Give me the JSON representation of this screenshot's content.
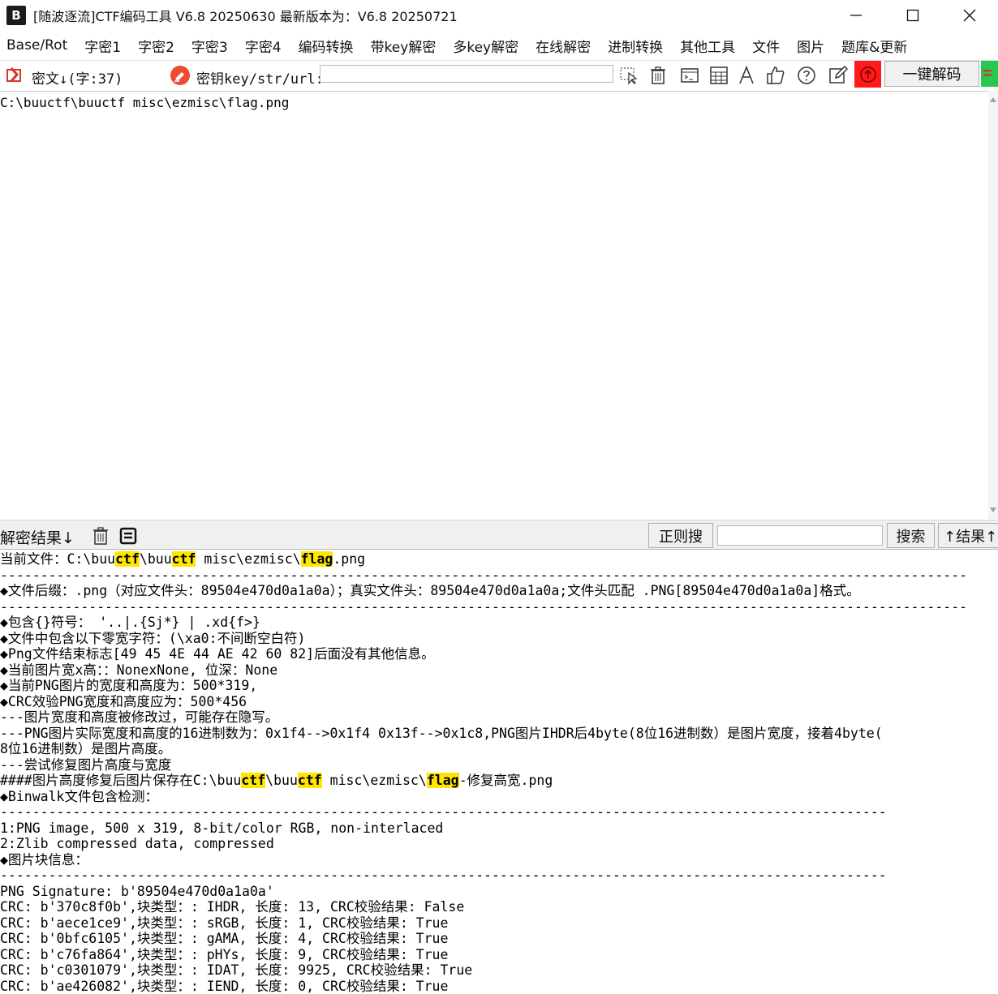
{
  "window": {
    "logo": "B",
    "title": "[随波逐流]CTF编码工具 V6.8 20250630    最新版本为：V6.8 20250721"
  },
  "menu": [
    "Base/Rot",
    "字密1",
    "字密2",
    "字密3",
    "字密4",
    "编码转换",
    "带key解密",
    "多key解密",
    "在线解密",
    "进制转换",
    "其他工具",
    "文件",
    "图片",
    "题库&更新"
  ],
  "toolbar": {
    "ciphertext_label": "密文↓(字:37)",
    "key_label": "密钥key/str/url:",
    "key_value": "",
    "decode_button": "一键解码",
    "green_tab_text": "="
  },
  "input": {
    "text": "C:\\buuctf\\buuctf misc\\ezmisc\\flag.png"
  },
  "result_bar": {
    "label": "解密结果↓",
    "regex_button": "正则搜",
    "regex_value": "",
    "search_button": "搜索",
    "result_up_button": "↑结果↑"
  },
  "output": {
    "lines": [
      [
        {
          "t": "当前文件：C:\\buu"
        },
        {
          "t": "ctf",
          "hl": true
        },
        {
          "t": "\\buu"
        },
        {
          "t": "ctf",
          "hl": true
        },
        {
          "t": " misc\\ezmisc\\"
        },
        {
          "t": "flag",
          "hl": true
        },
        {
          "t": ".png"
        }
      ],
      [
        {
          "t": "------------------------------------------------------------------------------------------------------------------------"
        }
      ],
      [
        {
          "t": "◆文件后缀：.png（对应文件头：89504e470d0a1a0a）；真实文件头：89504e470d0a1a0a;文件头匹配 .PNG[89504e470d0a1a0a]格式。"
        }
      ],
      [
        {
          "t": "------------------------------------------------------------------------------------------------------------------------"
        }
      ],
      [
        {
          "t": "◆包含{}符号： '..|.{Sj*} | .xd{f>}"
        }
      ],
      [
        {
          "t": "◆文件中包含以下零宽字符：(\\xa0:不间断空白符)"
        }
      ],
      [
        {
          "t": "◆Png文件结束标志[49 45 4E 44 AE 42 60 82]后面没有其他信息。"
        }
      ],
      [
        {
          "t": "◆当前图片宽x高：：NonexNone, 位深：None"
        }
      ],
      [
        {
          "t": "◆当前PNG图片的宽度和高度为：500*319,"
        }
      ],
      [
        {
          "t": "◆CRC效验PNG宽度和高度应为：500*456"
        }
      ],
      [
        {
          "t": "---图片宽度和高度被修改过，可能存在隐写。"
        }
      ],
      [
        {
          "t": "---PNG图片实际宽度和高度的16进制数为：0x1f4-->0x1f4 0x13f-->0x1c8,PNG图片IHDR后4byte(8位16进制数）是图片宽度，接着4byte("
        }
      ],
      [
        {
          "t": "8位16进制数）是图片高度。"
        }
      ],
      [
        {
          "t": "---尝试修复图片高度与宽度"
        }
      ],
      [
        {
          "t": "####图片高度修复后图片保存在C:\\buu"
        },
        {
          "t": "ctf",
          "hl": true
        },
        {
          "t": "\\buu"
        },
        {
          "t": "ctf",
          "hl": true
        },
        {
          "t": " misc\\ezmisc\\"
        },
        {
          "t": "flag",
          "hl": true
        },
        {
          "t": "-修复高宽.png"
        }
      ],
      [
        {
          "t": "◆Binwalk文件包含检测："
        }
      ],
      [
        {
          "t": "--------------------------------------------------------------------------------------------------------------"
        }
      ],
      [
        {
          "t": "1:PNG image, 500 x 319, 8-bit/color RGB, non-interlaced"
        }
      ],
      [
        {
          "t": "2:Zlib compressed data, compressed"
        }
      ],
      [
        {
          "t": "◆图片块信息："
        }
      ],
      [
        {
          "t": "--------------------------------------------------------------------------------------------------------------"
        }
      ],
      [
        {
          "t": "PNG Signature: b'89504e470d0a1a0a'"
        }
      ],
      [
        {
          "t": "CRC: b'370c8f0b',块类型：: IHDR, 长度: 13, CRC校验结果: False"
        }
      ],
      [
        {
          "t": "CRC: b'aece1ce9',块类型：: sRGB, 长度: 1, CRC校验结果: True"
        }
      ],
      [
        {
          "t": "CRC: b'0bfc6105',块类型：: gAMA, 长度: 4, CRC校验结果: True"
        }
      ],
      [
        {
          "t": "CRC: b'c76fa864',块类型：: pHYs, 长度: 9, CRC校验结果: True"
        }
      ],
      [
        {
          "t": "CRC: b'c0301079',块类型：: IDAT, 长度: 9925, CRC校验结果: True"
        }
      ],
      [
        {
          "t": "CRC: b'ae426082',块类型：: IEND, 长度: 0, CRC校验结果: True"
        }
      ]
    ]
  },
  "colors": {
    "highlight": "#ffe600",
    "red_button": "#ff1a1a",
    "green_tab": "#26c84f"
  }
}
